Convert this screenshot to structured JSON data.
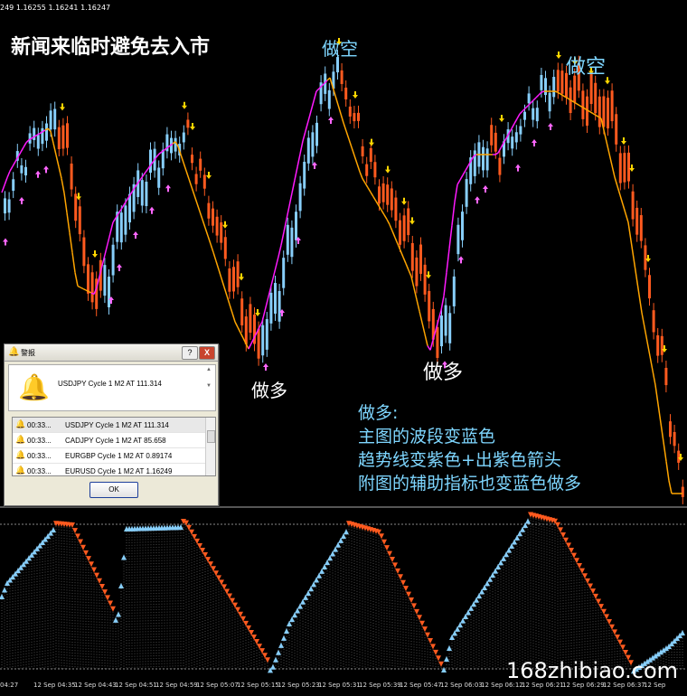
{
  "chart_header": "249 1.16255 1.16241 1.16247",
  "title_text": "新闻来临时避免去入市",
  "annotations": {
    "short_1": "做空",
    "short_2": "做空",
    "long_1": "做多",
    "long_2": "做多"
  },
  "notes": [
    "做多:",
    "主图的波段变蓝色",
    "趋势线变紫色+出紫色箭头",
    "附图的辅助指标也变蓝色做多"
  ],
  "alert_dialog": {
    "title": "警报",
    "main_message": "USDJPY Cycle 1 M2 AT 111.314",
    "entries": [
      {
        "time": "00:33...",
        "message": "USDJPY Cycle 1 M2 AT 111.314"
      },
      {
        "time": "00:33...",
        "message": "CADJPY Cycle 1 M2 AT 85.658"
      },
      {
        "time": "00:33...",
        "message": "EURGBP Cycle 1 M2 AT 0.89174"
      },
      {
        "time": "00:33...",
        "message": "EURUSD Cycle 1 M2 AT 1.16249"
      }
    ],
    "ok_label": "OK",
    "help_label": "?",
    "close_label": "X"
  },
  "x_axis_labels": [
    "04:27",
    "12 Sep 04:35",
    "12 Sep 04:43",
    "12 Sep 04:51",
    "12 Sep 04:59",
    "12 Sep 05:07",
    "12 Sep 05:15",
    "12 Sep 05:23",
    "12 Sep 05:31",
    "12 Sep 05:39",
    "12 Sep 05:47",
    "12 Sep 06:03",
    "12 Sep 06:12",
    "12 Sep 06:21",
    "12 Sep 06:29",
    "12 Sep 06:37",
    "12 Sep"
  ],
  "site_watermark": "168zhibiao.com",
  "colors": {
    "bull_candle": "#87cefa",
    "bear_candle": "#ff5a1f",
    "trend_up": "#ff1aff",
    "trend_down": "#ffa500",
    "arrow_up": "#ff66ff",
    "arrow_down": "#ffd700",
    "background": "#000000"
  }
}
